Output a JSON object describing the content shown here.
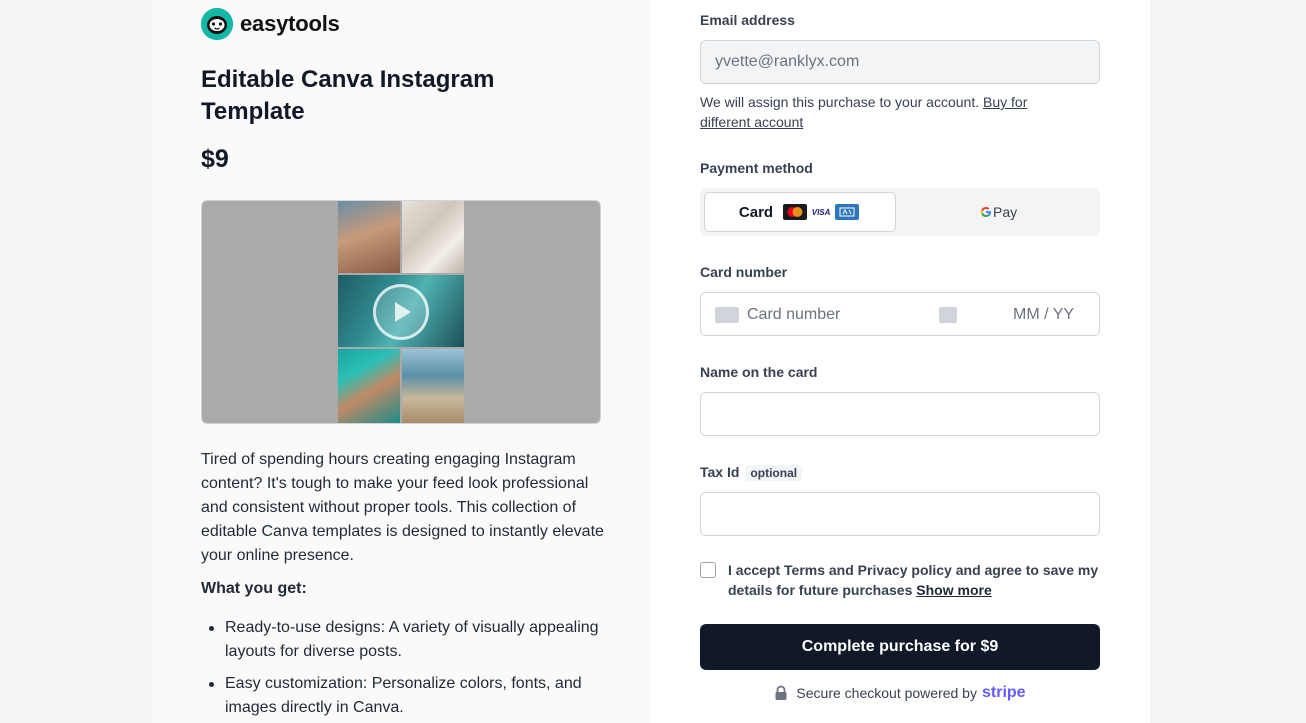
{
  "brand": {
    "name": "easytools"
  },
  "product": {
    "title": "Editable Canva Instagram Template",
    "price": "$9",
    "description": "Tired of spending hours creating engaging Instagram content? It's tough to make your feed look professional and consistent without proper tools. This collection of editable Canva templates is designed to instantly elevate your online presence.",
    "what_you_get": "What you get:",
    "features": [
      "Ready-to-use designs: A variety of visually appealing layouts for diverse posts.",
      "Easy customization: Personalize colors, fonts, and images directly in Canva."
    ]
  },
  "checkout": {
    "email_label": "Email address",
    "email_value": "yvette@ranklyx.com",
    "assign_note": "We will assign this purchase to your account.",
    "buy_for_other": "Buy for different account",
    "payment_method_label": "Payment method",
    "card_option": "Card",
    "card_brands": [
      "mastercard",
      "visa",
      "amex"
    ],
    "visa_text": "VISA",
    "gpay_text": "Pay",
    "card_number_label": "Card number",
    "card_number_placeholder": "Card number",
    "expiry_placeholder": "MM / YY",
    "name_label": "Name on the card",
    "tax_label": "Tax Id",
    "tax_optional": "optional",
    "terms_text": "I accept Terms and Privacy policy and agree to save my details for future purchases",
    "show_more": "Show more",
    "cta": "Complete purchase for $9",
    "secure_text": "Secure checkout powered by",
    "stripe": "stripe"
  },
  "colors": {
    "accent_teal": "#14b8a6",
    "cta_bg": "#111827",
    "stripe": "#635bff"
  }
}
